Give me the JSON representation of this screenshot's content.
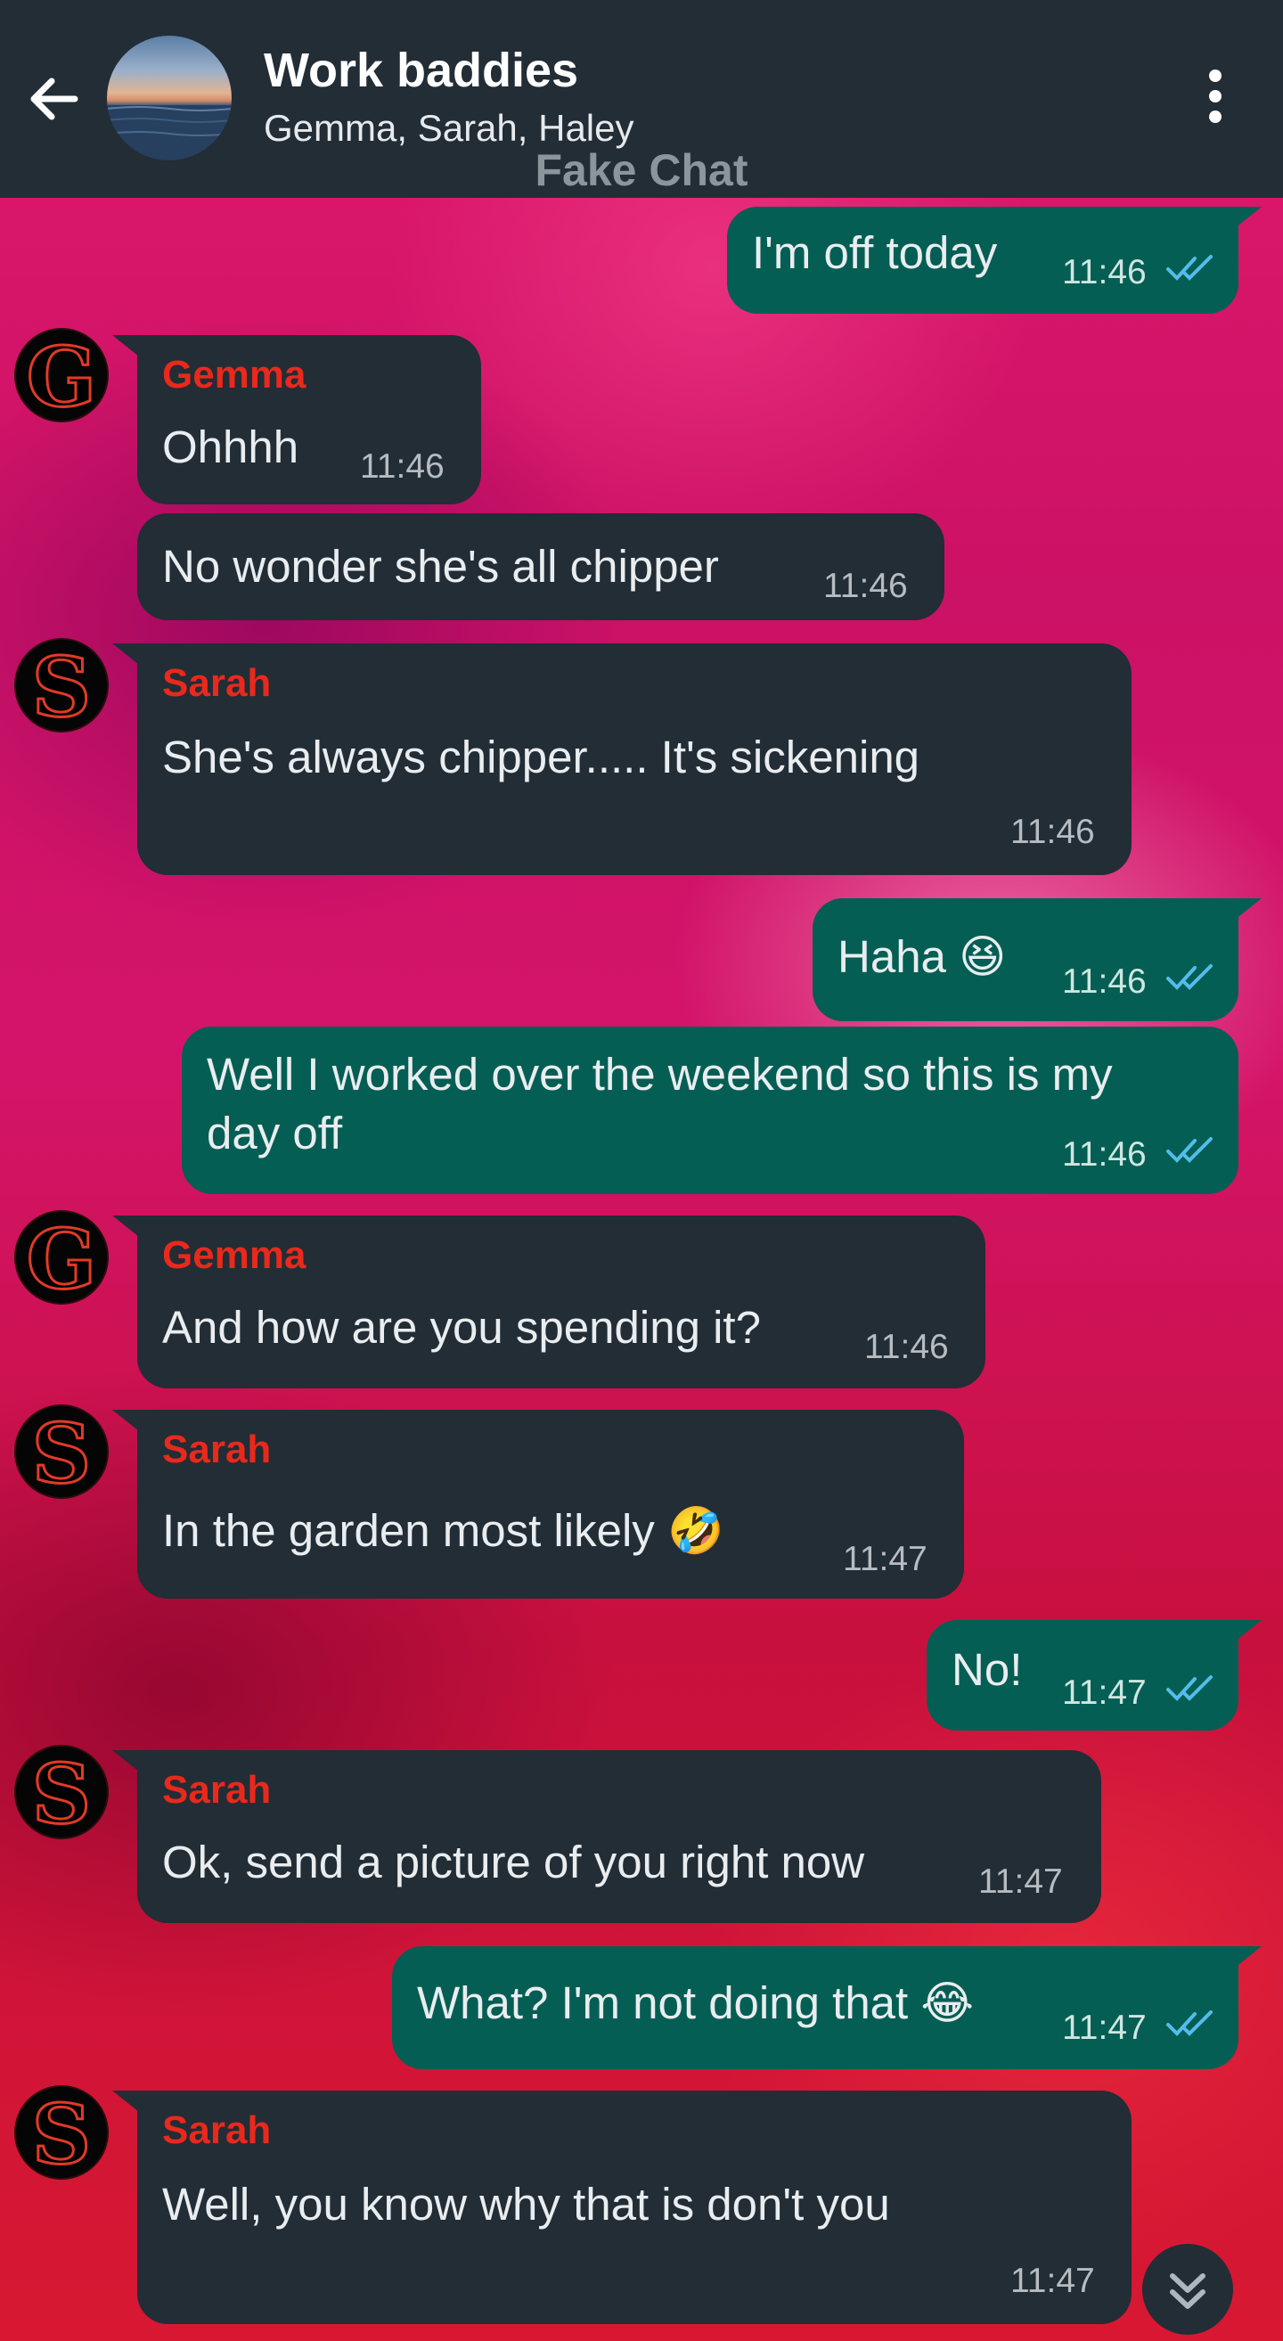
{
  "header": {
    "title": "Work baddies",
    "members": "Gemma, Sarah, Haley",
    "watermark": "Fake Chat"
  },
  "icons": {
    "back": "back-arrow-icon",
    "menu": "more-vert-icon",
    "scroll_down": "double-chevron-down-icon",
    "read": "double-check-icon"
  },
  "colors": {
    "header_bg": "#232d36",
    "incoming_bubble": "#222d36",
    "outgoing_bubble": "#055e54",
    "sender_name": "#e8291c",
    "read_ticks": "#53bdeb"
  },
  "messages": [
    {
      "dir": "out",
      "text": "I'm off today",
      "time": "11:46",
      "read": true
    },
    {
      "dir": "in",
      "sender": "Gemma",
      "avatar": "G",
      "text": "Ohhhh",
      "time": "11:46"
    },
    {
      "dir": "in",
      "text": "No wonder she's all chipper",
      "time": "11:46"
    },
    {
      "dir": "in",
      "sender": "Sarah",
      "avatar": "S",
      "text": "She's always chipper..... It's sickening",
      "time": "11:46"
    },
    {
      "dir": "out",
      "text": "Haha 😆",
      "time": "11:46",
      "read": true
    },
    {
      "dir": "out",
      "text_line1": "Well I worked over the weekend so this is my",
      "text_line2": "day off",
      "time": "11:46",
      "read": true
    },
    {
      "dir": "in",
      "sender": "Gemma",
      "avatar": "G",
      "text": "And how are you spending it?",
      "time": "11:46"
    },
    {
      "dir": "in",
      "sender": "Sarah",
      "avatar": "S",
      "text": "In the garden most likely 🤣",
      "time": "11:47"
    },
    {
      "dir": "out",
      "text": "No!",
      "time": "11:47",
      "read": true
    },
    {
      "dir": "in",
      "sender": "Sarah",
      "avatar": "S",
      "text": "Ok, send a picture of you right now",
      "time": "11:47"
    },
    {
      "dir": "out",
      "text": "What? I'm not doing that 😂",
      "time": "11:47",
      "read": true
    },
    {
      "dir": "in",
      "sender": "Sarah",
      "avatar": "S",
      "text": "Well, you know why that is don't you",
      "time": "11:47"
    }
  ]
}
